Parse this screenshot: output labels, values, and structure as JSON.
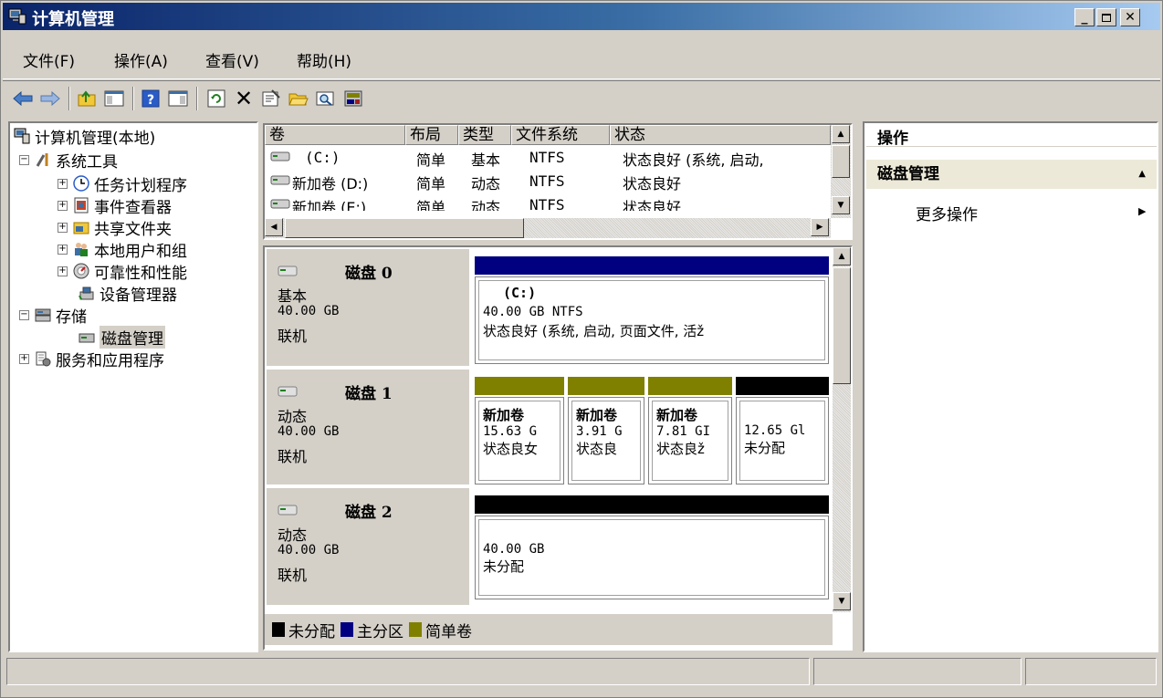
{
  "window": {
    "title": "计算机管理"
  },
  "menu": [
    "文件(F)",
    "操作(A)",
    "查看(V)",
    "帮助(H)"
  ],
  "tree": {
    "root": "计算机管理(本地)",
    "items": [
      {
        "label": "系统工具",
        "level": 1,
        "expander": "−"
      },
      {
        "label": "任务计划程序",
        "level": 2,
        "expander": "+"
      },
      {
        "label": "事件查看器",
        "level": 2,
        "expander": "+"
      },
      {
        "label": "共享文件夹",
        "level": 2,
        "expander": "+"
      },
      {
        "label": "本地用户和组",
        "level": 2,
        "expander": "+"
      },
      {
        "label": "可靠性和性能",
        "level": 2,
        "expander": "+"
      },
      {
        "label": "设备管理器",
        "level": 2,
        "expander": ""
      },
      {
        "label": "存储",
        "level": 1,
        "expander": "−"
      },
      {
        "label": "磁盘管理",
        "level": 2,
        "expander": "",
        "selected": true
      },
      {
        "label": "服务和应用程序",
        "level": 1,
        "expander": "+"
      }
    ]
  },
  "volume_list": {
    "columns": [
      "卷",
      "布局",
      "类型",
      "文件系统",
      "状态"
    ],
    "rows": [
      [
        "(C:)",
        "简单",
        "基本",
        "NTFS",
        "状态良好 (系统, 启动,"
      ],
      [
        "新加卷 (D:)",
        "简单",
        "动态",
        "NTFS",
        "状态良好"
      ],
      [
        "新加卷 (E:)",
        "简单",
        "动态",
        "NTFS",
        "状态良好"
      ]
    ]
  },
  "disks": [
    {
      "name": "磁盘 0",
      "type": "基本",
      "size": "40.00 GB",
      "status": "联机",
      "partitions": [
        {
          "title": "(C:)",
          "line1": "40.00 GB NTFS",
          "line2": "状态良好 (系统, 启动, 页面文件, 活ž",
          "color": "#000080"
        }
      ]
    },
    {
      "name": "磁盘 1",
      "type": "动态",
      "size": "40.00 GB",
      "status": "联机",
      "partitions": [
        {
          "title": "新加卷",
          "line1": "15.63 G",
          "line2": "状态良女",
          "color": "#808000"
        },
        {
          "title": "新加卷",
          "line1": "3.91 G",
          "line2": "状态良",
          "color": "#808000"
        },
        {
          "title": "新加卷",
          "line1": "7.81 GI",
          "line2": "状态良ž",
          "color": "#808000"
        },
        {
          "title": "",
          "line1": "12.65 Gl",
          "line2": "未分配",
          "color": "#000000"
        }
      ]
    },
    {
      "name": "磁盘 2",
      "type": "动态",
      "size": "40.00 GB",
      "status": "联机",
      "partitions": [
        {
          "title": "",
          "line1": "40.00 GB",
          "line2": "未分配",
          "color": "#000000"
        }
      ]
    }
  ],
  "legend": [
    {
      "label": "未分配",
      "color": "#000000"
    },
    {
      "label": "主分区",
      "color": "#000080"
    },
    {
      "label": "简单卷",
      "color": "#808000"
    }
  ],
  "actions": {
    "title": "操作",
    "group": "磁盘管理",
    "more": "更多操作"
  }
}
